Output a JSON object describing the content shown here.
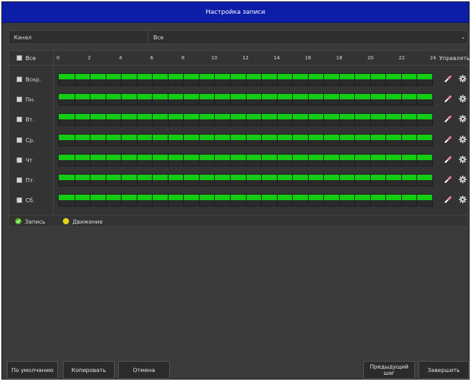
{
  "title": "Настройка записи",
  "channel": {
    "label": "Канал",
    "value": "Все",
    "arrow_icon": "chevron-down-icon"
  },
  "schedule": {
    "select_all_label": "Все",
    "hours": [
      "0",
      "2",
      "4",
      "6",
      "8",
      "10",
      "12",
      "14",
      "16",
      "18",
      "20",
      "22",
      "24"
    ],
    "manage_label": "Управлять",
    "days": [
      {
        "label": "Вскр.",
        "record_start_hour": 0,
        "record_end_hour": 24
      },
      {
        "label": "Пн.",
        "record_start_hour": 0,
        "record_end_hour": 24
      },
      {
        "label": "Вт.",
        "record_start_hour": 0,
        "record_end_hour": 24
      },
      {
        "label": "Ср.",
        "record_start_hour": 0,
        "record_end_hour": 24
      },
      {
        "label": "Чт",
        "record_start_hour": 0,
        "record_end_hour": 24
      },
      {
        "label": "Пт.",
        "record_start_hour": 0,
        "record_end_hour": 24
      },
      {
        "label": "Сб.",
        "record_start_hour": 0,
        "record_end_hour": 24
      }
    ],
    "row_icons": [
      "eraser-icon",
      "gear-icon"
    ]
  },
  "legend": [
    {
      "label": "Запись",
      "color": "#4fc41a",
      "icon": "check-icon"
    },
    {
      "label": "Движение",
      "color": "#e6d21a"
    }
  ],
  "buttons": {
    "default": "По умолчанию",
    "copy": "Копировать",
    "cancel": "Отмена",
    "prev": "Предыдущий шаг",
    "finish": "Завершить"
  },
  "colors": {
    "title_bar": "#0c1ea8",
    "record": "#14cc14",
    "background": "#3a3a3a"
  }
}
